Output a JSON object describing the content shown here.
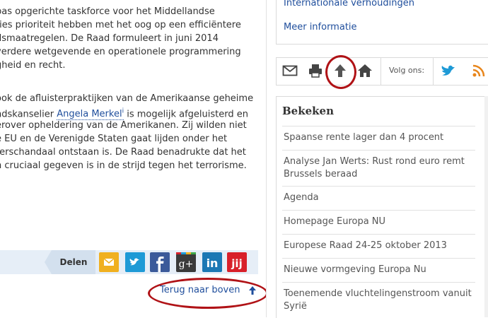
{
  "article": {
    "para1": [
      "pas opgerichte taskforce voor het Middellandse",
      "ties prioriteit hebben met het oog op een efficiëntere",
      "dsmaatregelen. De Raad formuleert in juni 2014",
      "verdere wetgevende en operationele programmering",
      "gheid en recht."
    ],
    "para2_line1": "ook de afluisterpraktijken van de Amerikaanse geheime",
    "para2_line2_pre": "ndskanselier ",
    "para2_link": "Angela Merkel",
    "para2_link_sup": "i",
    "para2_line2_post": " is mogelijk afgeluisterd en",
    "para2_rest": [
      "erover opheldering van de Amerikanen. Zij wilden niet",
      "e EU en de Verenigde Staten gaat lijden onder het",
      "terschandaal ontstaan is. De Raad benadrukte dat het",
      "n cruciaal gegeven is in de strijd tegen het terrorisme."
    ]
  },
  "share": {
    "label": "Delen",
    "buttons": [
      {
        "name": "email",
        "color": "#f0b020"
      },
      {
        "name": "twitter",
        "color": "#1e9ad6"
      },
      {
        "name": "facebook",
        "color": "#3b5a9a"
      },
      {
        "name": "google-plus",
        "color": "#3a3a3a"
      },
      {
        "name": "linkedin",
        "color": "#1b78b4"
      },
      {
        "name": "nujij",
        "color": "#d8202a"
      }
    ]
  },
  "back_to_top": "Terug naar boven",
  "sidebar": {
    "links": [
      "Internationale verhoudingen",
      "Meer informatie"
    ],
    "follow_label": "Volg ons:",
    "bekeken_title": "Bekeken",
    "bekeken_items": [
      "Spaanse rente lager dan 4 procent",
      "Analyse Jan Werts: Rust rond euro remt Brussels beraad",
      "Agenda",
      "Homepage Europa NU",
      "Europese Raad 24-25 oktober 2013",
      "Nieuwe vormgeving Europa Nu",
      "Toenemende vluchtelingenstroom vanuit Syrië"
    ]
  },
  "colors": {
    "link": "#1f4e9c",
    "highlight_ring": "#b01216"
  }
}
